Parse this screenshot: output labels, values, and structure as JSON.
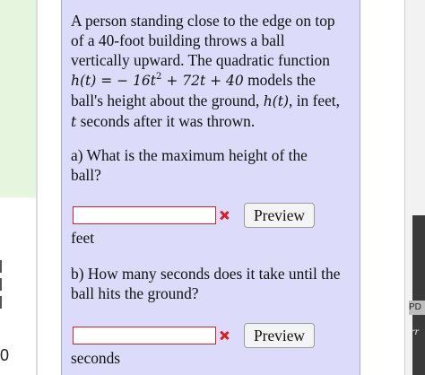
{
  "left_panel": {
    "glyph": "0"
  },
  "right_strip": {
    "tag": "PD",
    "tag2": "rr"
  },
  "problem": {
    "line1": "A person standing close to the edge on top",
    "line2": "of a 40-foot building throws a ball",
    "line3": "vertically upward. The quadratic function",
    "fn_lhs": "h(t)",
    "fn_eq": " = ",
    "fn_rhs_a": " − 16t",
    "fn_exp": "2",
    "fn_rhs_b": " + 72t + 40",
    "line4_tail": " models the",
    "line5_a": "ball's height about the ground, ",
    "line5_math": "h(t)",
    "line5_b": ", in feet,",
    "line6_math": "t",
    "line6_b": " seconds after it was thrown."
  },
  "part_a": {
    "question_line1": "a) What is the maximum height of the",
    "question_line2": "ball?",
    "answer_value": "",
    "preview_label": "Preview",
    "unit": "feet"
  },
  "part_b": {
    "question_line1": "b) How many seconds does it take until the",
    "question_line2": "ball hits the ground?",
    "answer_value": "",
    "preview_label": "Preview",
    "unit": "seconds"
  },
  "colors": {
    "card_bg": "#dcdcfa",
    "error_red": "#d2232a"
  }
}
